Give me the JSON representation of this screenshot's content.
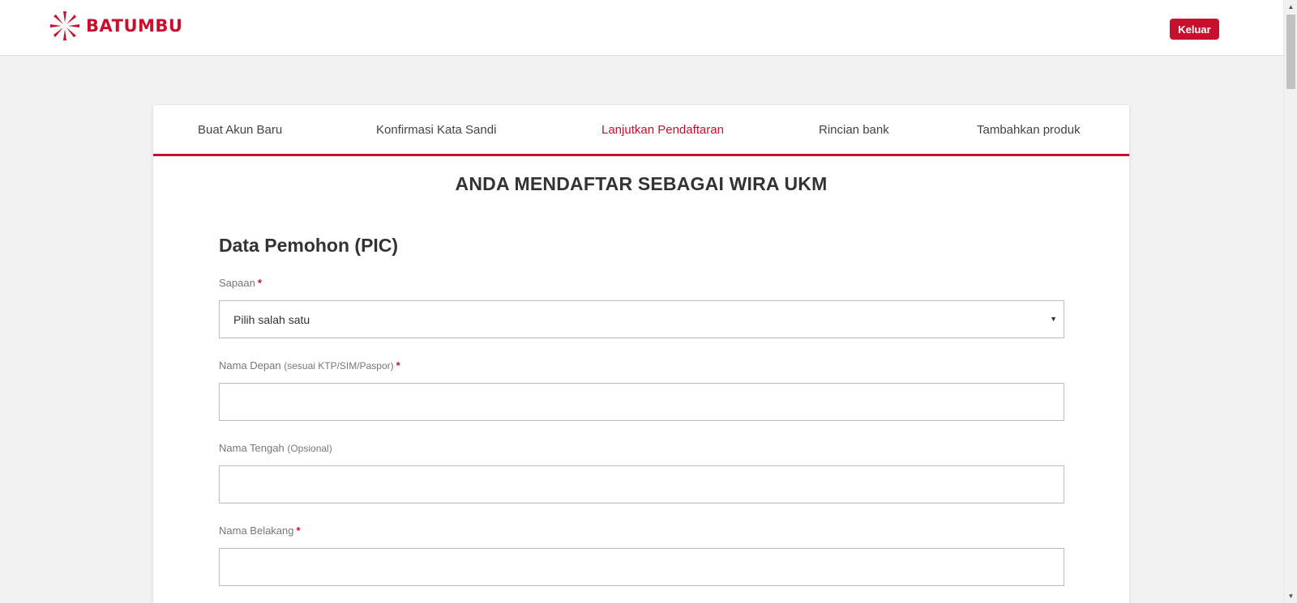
{
  "header": {
    "brand": "BATUMBU",
    "logout_label": "Keluar"
  },
  "steps": [
    {
      "label": "Buat Akun Baru",
      "active": false
    },
    {
      "label": "Konfirmasi Kata Sandi",
      "active": false
    },
    {
      "label": "Lanjutkan Pendaftaran",
      "active": true
    },
    {
      "label": "Rincian bank",
      "active": false
    },
    {
      "label": "Tambahkan produk",
      "active": false
    }
  ],
  "form": {
    "title": "ANDA MENDAFTAR SEBAGAI WIRA UKM",
    "section_title": "Data Pemohon (PIC)",
    "fields": {
      "salutation": {
        "label": "Sapaan",
        "required": "*",
        "selected": "Pilih salah satu"
      },
      "first_name": {
        "label": "Nama Depan",
        "hint": "(sesuai KTP/SIM/Paspor)",
        "required": "*",
        "value": ""
      },
      "middle_name": {
        "label": "Nama Tengah",
        "hint": "(Opsional)",
        "value": ""
      },
      "last_name": {
        "label": "Nama Belakang",
        "required": "*",
        "value": ""
      }
    }
  },
  "colors": {
    "brand": "#c8102e",
    "background": "#f2f2f2",
    "card": "#ffffff"
  },
  "icons": {
    "logo": "batumbu-logo-icon",
    "dropdown": "chevron-down-icon"
  }
}
